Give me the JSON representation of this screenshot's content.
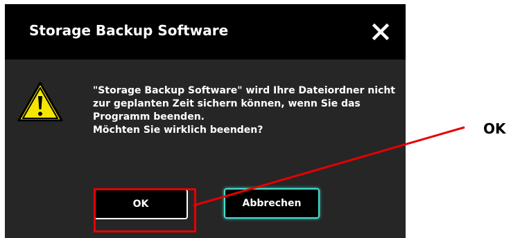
{
  "dialog": {
    "title": "Storage Backup Software",
    "close_icon": "close-icon",
    "warning_icon": "warning-triangle-icon",
    "message_lines": [
      "\"Storage Backup Software\" wird Ihre Dateiordner nicht",
      "zur geplanten Zeit sichern können, wenn Sie das",
      "Programm beenden.",
      "Möchten Sie wirklich beenden?"
    ],
    "buttons": {
      "ok_label": "OK",
      "cancel_label": "Abbrechen"
    }
  },
  "annotation": {
    "label": "OK",
    "color": "#e60000"
  },
  "colors": {
    "title_bar": "#000000",
    "dialog_body": "#262626",
    "warning_yellow": "#f5e600",
    "cancel_accent": "#40e0d0"
  }
}
